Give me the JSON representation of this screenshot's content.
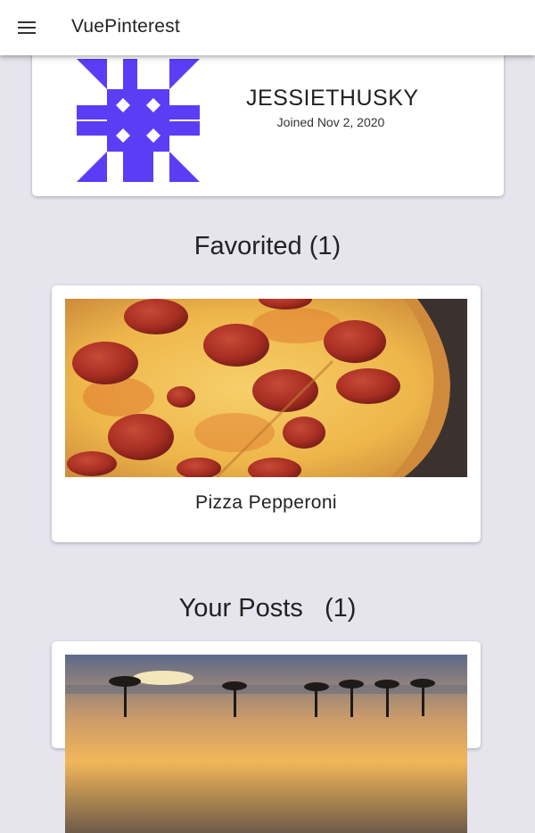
{
  "appbar": {
    "title": "VuePinterest",
    "menu_icon": "menu-icon"
  },
  "profile": {
    "username": "JESSIETHUSKY",
    "joined": "Joined Nov 2, 2020",
    "avatar_icon": "identicon-avatar",
    "avatar_color": "#5b3df6"
  },
  "favorited": {
    "label": "Favorited",
    "count": "(1)",
    "items": [
      {
        "title": "Pizza Pepperoni",
        "image": "pepperoni-pizza-photo"
      }
    ]
  },
  "your_posts": {
    "label": "Your Posts",
    "count": "(1)",
    "items": [
      {
        "title": "",
        "image": "beach-sunset-photo"
      }
    ]
  },
  "colors": {
    "background": "#e6e5ee",
    "card": "#ffffff",
    "text": "#222222"
  }
}
